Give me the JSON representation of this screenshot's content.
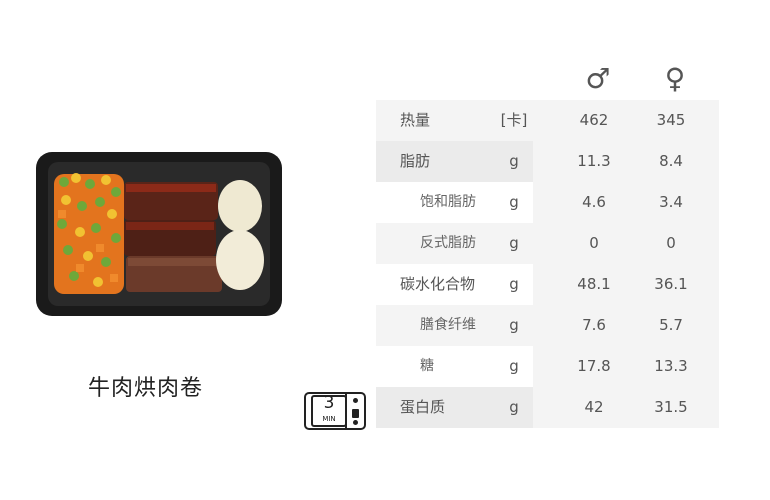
{
  "dish": {
    "name": "牛肉烘肉卷"
  },
  "microwave": {
    "minutes": "3",
    "unit": "MIN"
  },
  "headers": {
    "male_symbol": "♂",
    "female_symbol": "♀"
  },
  "rows": [
    {
      "label": "热量",
      "unit": "[卡]",
      "male": "462",
      "female": "345"
    },
    {
      "label": "脂肪",
      "unit": "g",
      "male": "11.3",
      "female": "8.4"
    },
    {
      "label": "饱和脂肪",
      "unit": "g",
      "male": "4.6",
      "female": "3.4"
    },
    {
      "label": "反式脂肪",
      "unit": "g",
      "male": "0",
      "female": "0"
    },
    {
      "label": "碳水化合物",
      "unit": "g",
      "male": "48.1",
      "female": "36.1"
    },
    {
      "label": "膳食纤维",
      "unit": "g",
      "male": "7.6",
      "female": "5.7"
    },
    {
      "label": "糖",
      "unit": "g",
      "male": "17.8",
      "female": "13.3"
    },
    {
      "label": "蛋白质",
      "unit": "g",
      "male": "42",
      "female": "31.5"
    }
  ]
}
